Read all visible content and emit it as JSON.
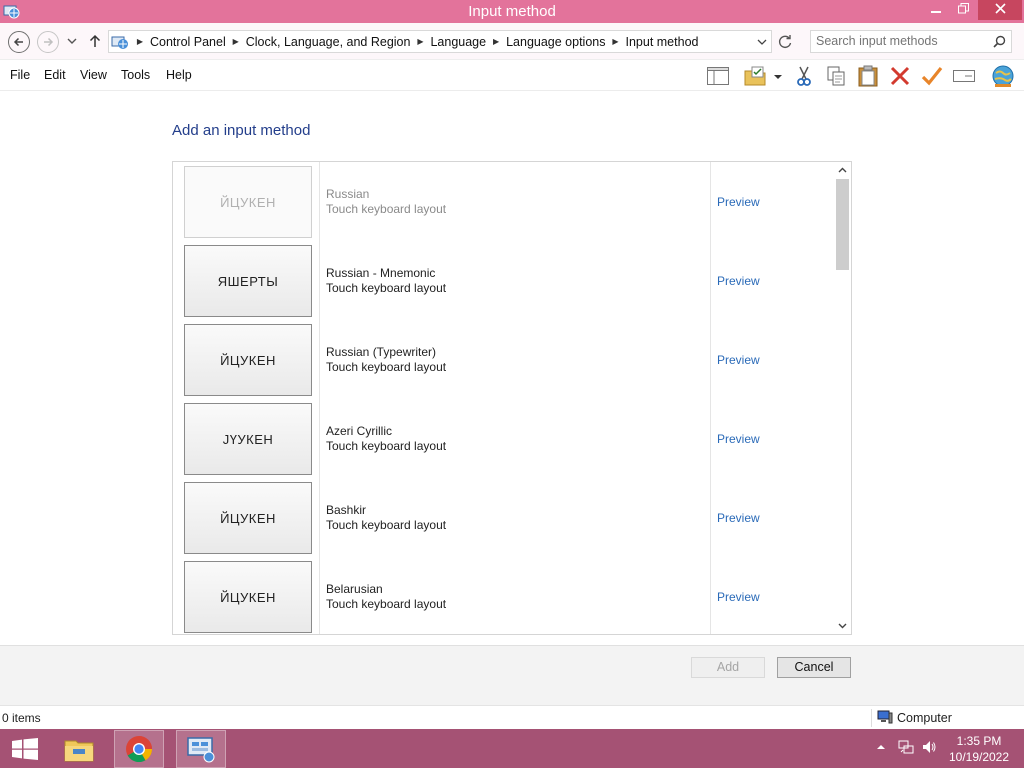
{
  "window": {
    "title": "Input method",
    "minimize_icon": "minimize-icon",
    "maximize_icon": "restore-icon",
    "close_icon": "close-icon"
  },
  "address_bar": {
    "breadcrumbs": [
      "Control Panel",
      "Clock, Language, and Region",
      "Language",
      "Language options",
      "Input method"
    ],
    "search_placeholder": "Search input methods"
  },
  "menu": {
    "items": [
      "File",
      "Edit",
      "View",
      "Tools",
      "Help"
    ]
  },
  "toolbar": {
    "icons": [
      "layout-pane-icon",
      "properties-folder-icon",
      "dropdown-icon",
      "cut-icon",
      "copy-icon",
      "paste-icon",
      "delete-icon",
      "checkmark-icon",
      "rename-icon",
      "globe-icon"
    ]
  },
  "content": {
    "heading": "Add an input method",
    "items": [
      {
        "layout": "ЙЦУКЕН",
        "name": "Russian",
        "type": "Touch keyboard layout",
        "preview": "Preview",
        "dimmed": true
      },
      {
        "layout": "ЯШЕРТЫ",
        "name": "Russian - Mnemonic",
        "type": "Touch keyboard layout",
        "preview": "Preview",
        "dimmed": false
      },
      {
        "layout": "ЙЦУКЕН",
        "name": "Russian (Typewriter)",
        "type": "Touch keyboard layout",
        "preview": "Preview",
        "dimmed": false
      },
      {
        "layout": "JҮУКЕН",
        "name": "Azeri Cyrillic",
        "type": "Touch keyboard layout",
        "preview": "Preview",
        "dimmed": false
      },
      {
        "layout": "ЙЦУКЕН",
        "name": "Bashkir",
        "type": "Touch keyboard layout",
        "preview": "Preview",
        "dimmed": false
      },
      {
        "layout": "ЙЦУКЕН",
        "name": "Belarusian",
        "type": "Touch keyboard layout",
        "preview": "Preview",
        "dimmed": false
      }
    ]
  },
  "buttons": {
    "add": "Add",
    "cancel": "Cancel"
  },
  "status": {
    "items": "0 items",
    "location": "Computer"
  },
  "taskbar": {
    "apps": [
      "file-explorer-icon",
      "chrome-icon",
      "control-panel-icon"
    ],
    "time": "1:35 PM",
    "date": "10/19/2022"
  },
  "colors": {
    "titlebar": "#e3739b",
    "taskbar": "#a55274",
    "link": "#2a6ab8",
    "heading": "#233e8b"
  }
}
